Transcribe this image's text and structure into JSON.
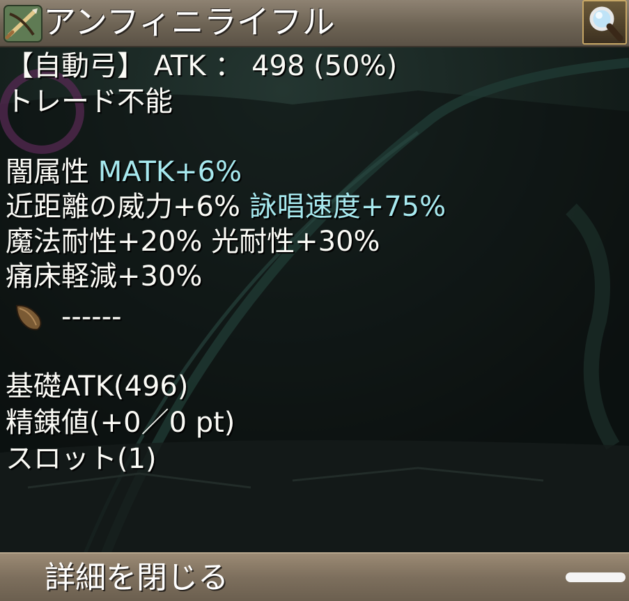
{
  "header": {
    "title": "アンフィニライフル",
    "weapon_icon": "crossbow-icon",
    "search_icon": "magnifier-icon"
  },
  "item": {
    "line1_type": "【自動弓】",
    "line1_atk": "ATK ： 498 (50%)",
    "tradable": "トレード不能",
    "element_label": "闇属性",
    "element_bonus": "MATK+6%",
    "melee_power": "近距離の威力+6%",
    "cast_speed": "詠唱速度+75%",
    "magic_res": "魔法耐性+20%",
    "light_res": "光耐性+30%",
    "pain_reduction": "痛床軽減+30%",
    "card_slot": "------",
    "base_atk": "基礎ATK(496)",
    "refine": "精錬値(+0／0 pt)",
    "slots": "スロット(1)"
  },
  "footer": {
    "close_label": "詳細を閉じる"
  },
  "colors": {
    "accent_cyan": "#a7e9ef",
    "panel_brown": "#7d6f5d",
    "text_white": "#fbfbf6"
  }
}
